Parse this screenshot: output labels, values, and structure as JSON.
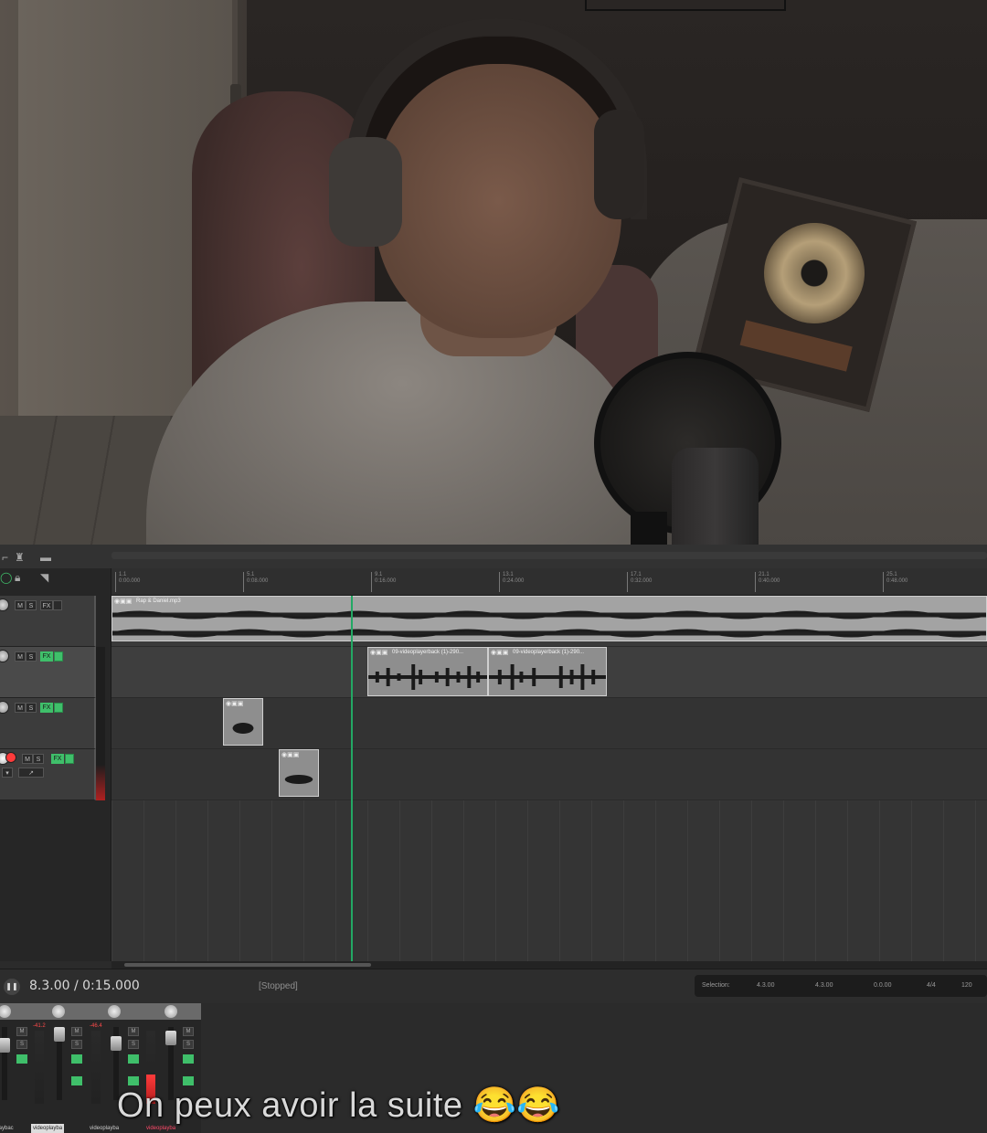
{
  "transport": {
    "time": "8.3.00 / 0:15.000",
    "status": "[Stopped]",
    "selection_label": "Selection:",
    "sel_start": "4.3.00",
    "sel_end": "4.3.00",
    "sel_length": "0.0.00",
    "time_sig": "4/4",
    "tempo": "120"
  },
  "ruler": {
    "marks": [
      "1.1\n0:00.000",
      "5.1\n0:08.000",
      "9.1\n0:16.000",
      "13.1\n0:24.000",
      "17.1\n0:32.000",
      "21.1\n0:40.000",
      "25.1\n0:48.000"
    ]
  },
  "tracks": [
    {
      "item_title": "Rap & Daniel.mp3"
    },
    {
      "item_title_a": "09-videoplayerback (1)-290...",
      "item_title_b": "09-videoplayerback (1)-290..."
    },
    {
      "item_title": ""
    },
    {
      "item_title": ""
    }
  ],
  "mixer": {
    "tabs": [
      "playbac",
      "videoplayba",
      "videoplayba",
      "videoplayba"
    ],
    "peak_labels": [
      "-41.2",
      "-46.4"
    ]
  },
  "caption": "On peux avoir la suite 😂😂"
}
